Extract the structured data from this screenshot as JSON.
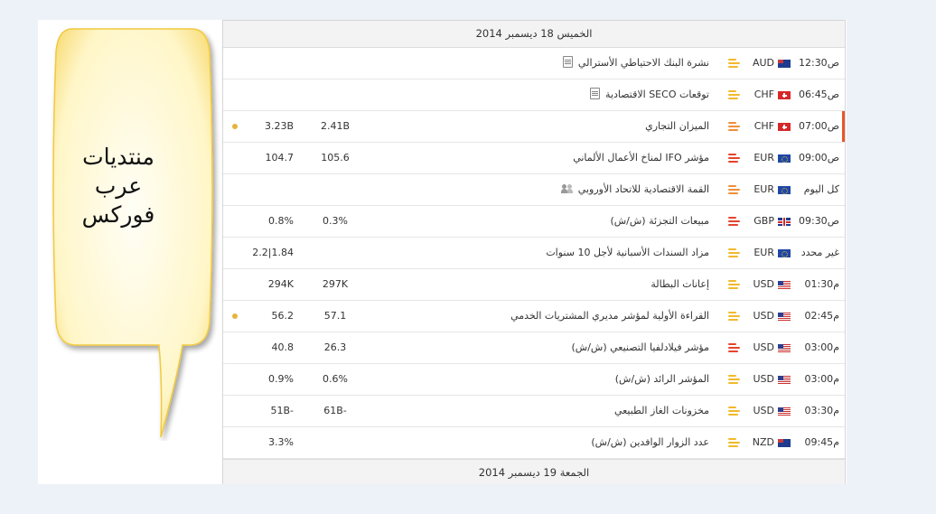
{
  "bubble": {
    "lines": [
      "منتديات",
      "عرب",
      "فوركس"
    ]
  },
  "calendar": {
    "header_top": "الخميس 18 ديسمبر 2014",
    "header_bottom": "الجمعة 19 ديسمبر 2014",
    "rows": [
      {
        "time": "12:30ص",
        "currency": "AUD",
        "flag": "aud",
        "importance": "low",
        "event": "نشرة البنك الاحتياطي الأسترالي",
        "icon": "doc",
        "actual": "",
        "forecast": "",
        "previous": "",
        "dot": false,
        "active": false
      },
      {
        "time": "06:45ص",
        "currency": "CHF",
        "flag": "chf",
        "importance": "low",
        "event": "توقعات SECO الاقتصادية",
        "icon": "doc",
        "actual": "",
        "forecast": "",
        "previous": "",
        "dot": false,
        "active": false
      },
      {
        "time": "07:00ص",
        "currency": "CHF",
        "flag": "chf",
        "importance": "med",
        "event": "الميزان التجاري",
        "icon": "",
        "actual": "2.41B",
        "forecast": "",
        "previous": "3.23B",
        "dot": true,
        "active": true
      },
      {
        "time": "09:00ص",
        "currency": "EUR",
        "flag": "eur",
        "importance": "high",
        "event": "مؤشر IFO لمناخ الأعمال الألماني",
        "icon": "",
        "actual": "105.6",
        "forecast": "",
        "previous": "104.7",
        "dot": false,
        "active": false
      },
      {
        "time": "كل اليوم",
        "currency": "EUR",
        "flag": "eur",
        "importance": "med",
        "event": "القمة الاقتصادية للاتحاد الأوروبي",
        "icon": "people",
        "actual": "",
        "forecast": "",
        "previous": "",
        "dot": false,
        "active": false
      },
      {
        "time": "09:30ص",
        "currency": "GBP",
        "flag": "gbp",
        "importance": "high",
        "event": "مبيعات التجزئة (ش/ش)",
        "icon": "",
        "actual": "0.3%",
        "forecast": "",
        "previous": "0.8%",
        "dot": false,
        "active": false
      },
      {
        "time": "غير محدد",
        "currency": "EUR",
        "flag": "eur",
        "importance": "low",
        "event": "مزاد السندات الأسبانية لأجل 10 سنوات",
        "icon": "",
        "actual": "",
        "forecast": "",
        "previous": "2.2|1.84",
        "dot": false,
        "active": false
      },
      {
        "time": "01:30م",
        "currency": "USD",
        "flag": "usd",
        "importance": "low",
        "event": "إعانات البطالة",
        "icon": "",
        "actual": "297K",
        "forecast": "",
        "previous": "294K",
        "dot": false,
        "active": false
      },
      {
        "time": "02:45م",
        "currency": "USD",
        "flag": "usd",
        "importance": "low",
        "event": "القراءة الأولية لمؤشر مديري المشتريات الخدمي",
        "icon": "",
        "actual": "57.1",
        "forecast": "",
        "previous": "56.2",
        "dot": true,
        "active": false
      },
      {
        "time": "03:00م",
        "currency": "USD",
        "flag": "usd",
        "importance": "high",
        "event": "مؤشر فيلادلفيا التصنيعي (ش/ش)",
        "icon": "",
        "actual": "26.3",
        "forecast": "",
        "previous": "40.8",
        "dot": false,
        "active": false
      },
      {
        "time": "03:00م",
        "currency": "USD",
        "flag": "usd",
        "importance": "low",
        "event": "المؤشر الرائد (ش/ش)",
        "icon": "",
        "actual": "0.6%",
        "forecast": "",
        "previous": "0.9%",
        "dot": false,
        "active": false
      },
      {
        "time": "03:30م",
        "currency": "USD",
        "flag": "usd",
        "importance": "low",
        "event": "مخزونات الغاز الطبيعي",
        "icon": "",
        "actual": "61B-",
        "forecast": "",
        "previous": "51B-",
        "dot": false,
        "active": false
      },
      {
        "time": "09:45م",
        "currency": "NZD",
        "flag": "nzd",
        "importance": "low",
        "event": "عدد الزوار الوافدين (ش/ش)",
        "icon": "",
        "actual": "",
        "forecast": "",
        "previous": "3.3%",
        "dot": false,
        "active": false
      }
    ]
  },
  "colors": {
    "background": "#edf2f9",
    "active_marker": "#e8572a",
    "importance_low": "#f2b92c",
    "importance_med": "#ef8f39",
    "importance_high": "#e4442e",
    "dot": "#e6b43a",
    "bubble_fill": "#fffbe0",
    "bubble_edge": "#f2cd4a"
  }
}
